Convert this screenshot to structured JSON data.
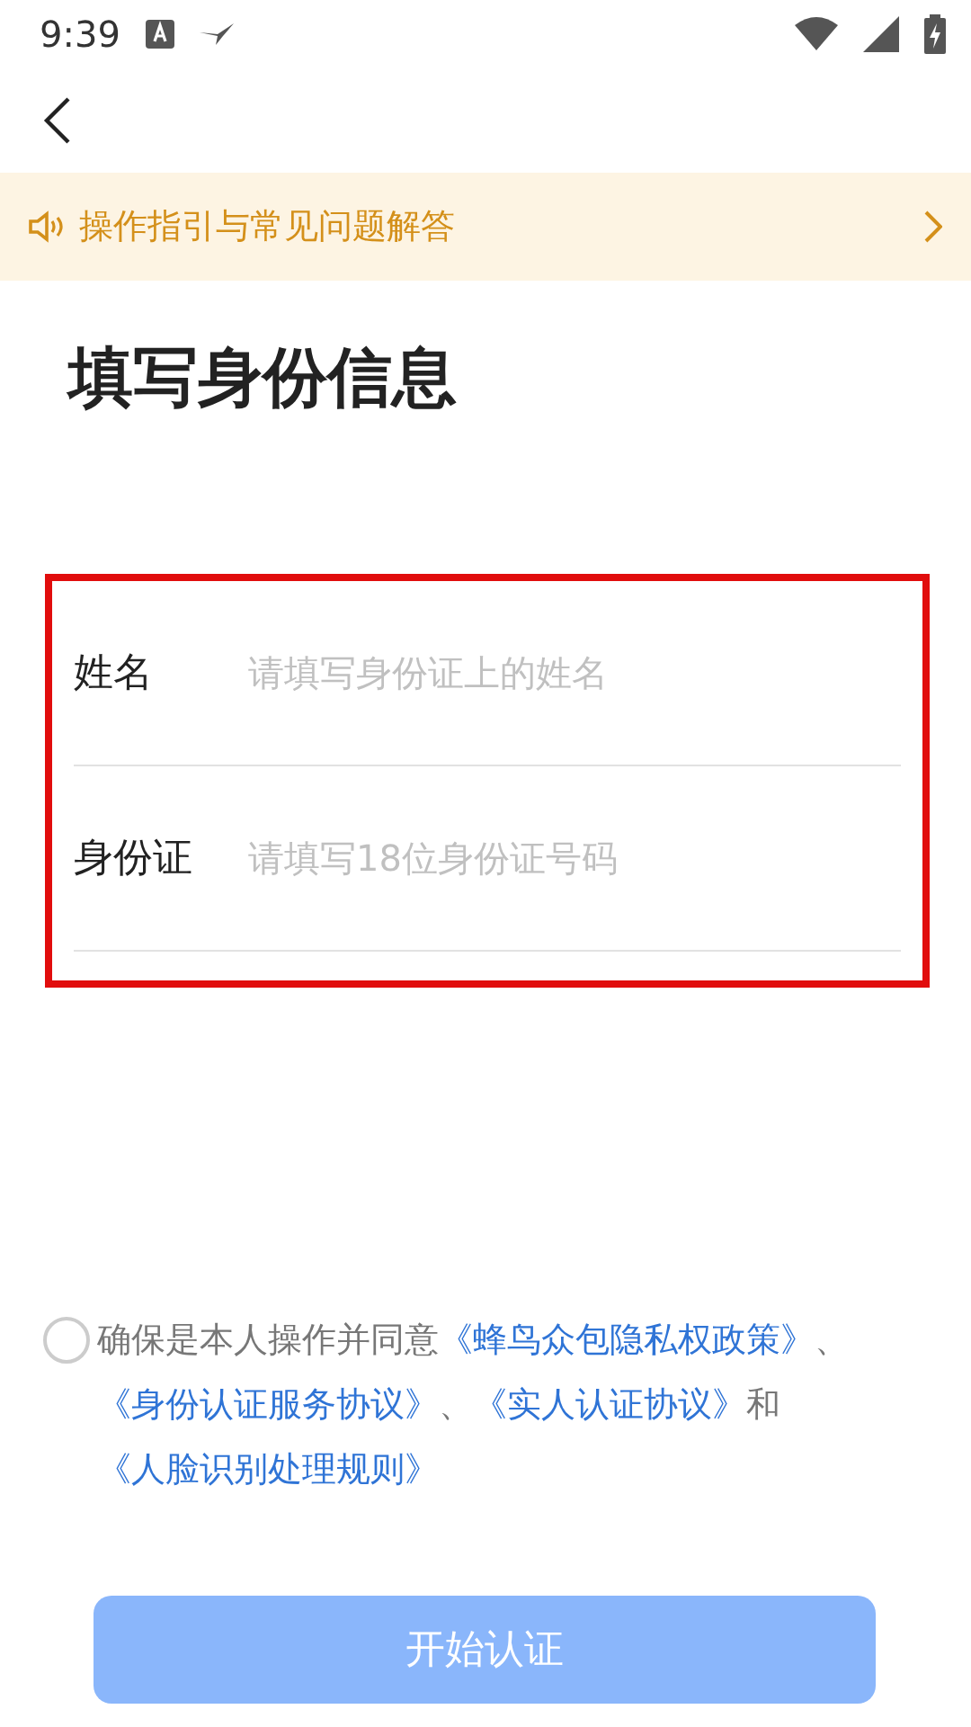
{
  "status_bar": {
    "time": "9:39"
  },
  "notice": {
    "text": "操作指引与常见问题解答"
  },
  "title": "填写身份信息",
  "annotations": {
    "highlight_frame": true
  },
  "fields": [
    {
      "label": "姓名",
      "placeholder": "请填写身份证上的姓名"
    },
    {
      "label": "身份证",
      "placeholder": "请填写18位身份证号码"
    }
  ],
  "agreement": {
    "checked": false,
    "segments": [
      {
        "kind": "text",
        "text": "确保是本人操作并同意"
      },
      {
        "kind": "link",
        "text": "《蜂鸟众包隐私权政策》"
      },
      {
        "kind": "text",
        "text": "、"
      },
      {
        "kind": "link",
        "text": "《身份认证服务协议》"
      },
      {
        "kind": "text",
        "text": "、"
      },
      {
        "kind": "link",
        "text": "《实人认证协议》"
      },
      {
        "kind": "text",
        "text": "和"
      },
      {
        "kind": "link",
        "text": "《人脸识别处理规则》"
      }
    ]
  },
  "submit": {
    "label": "开始认证",
    "disabled": true
  }
}
